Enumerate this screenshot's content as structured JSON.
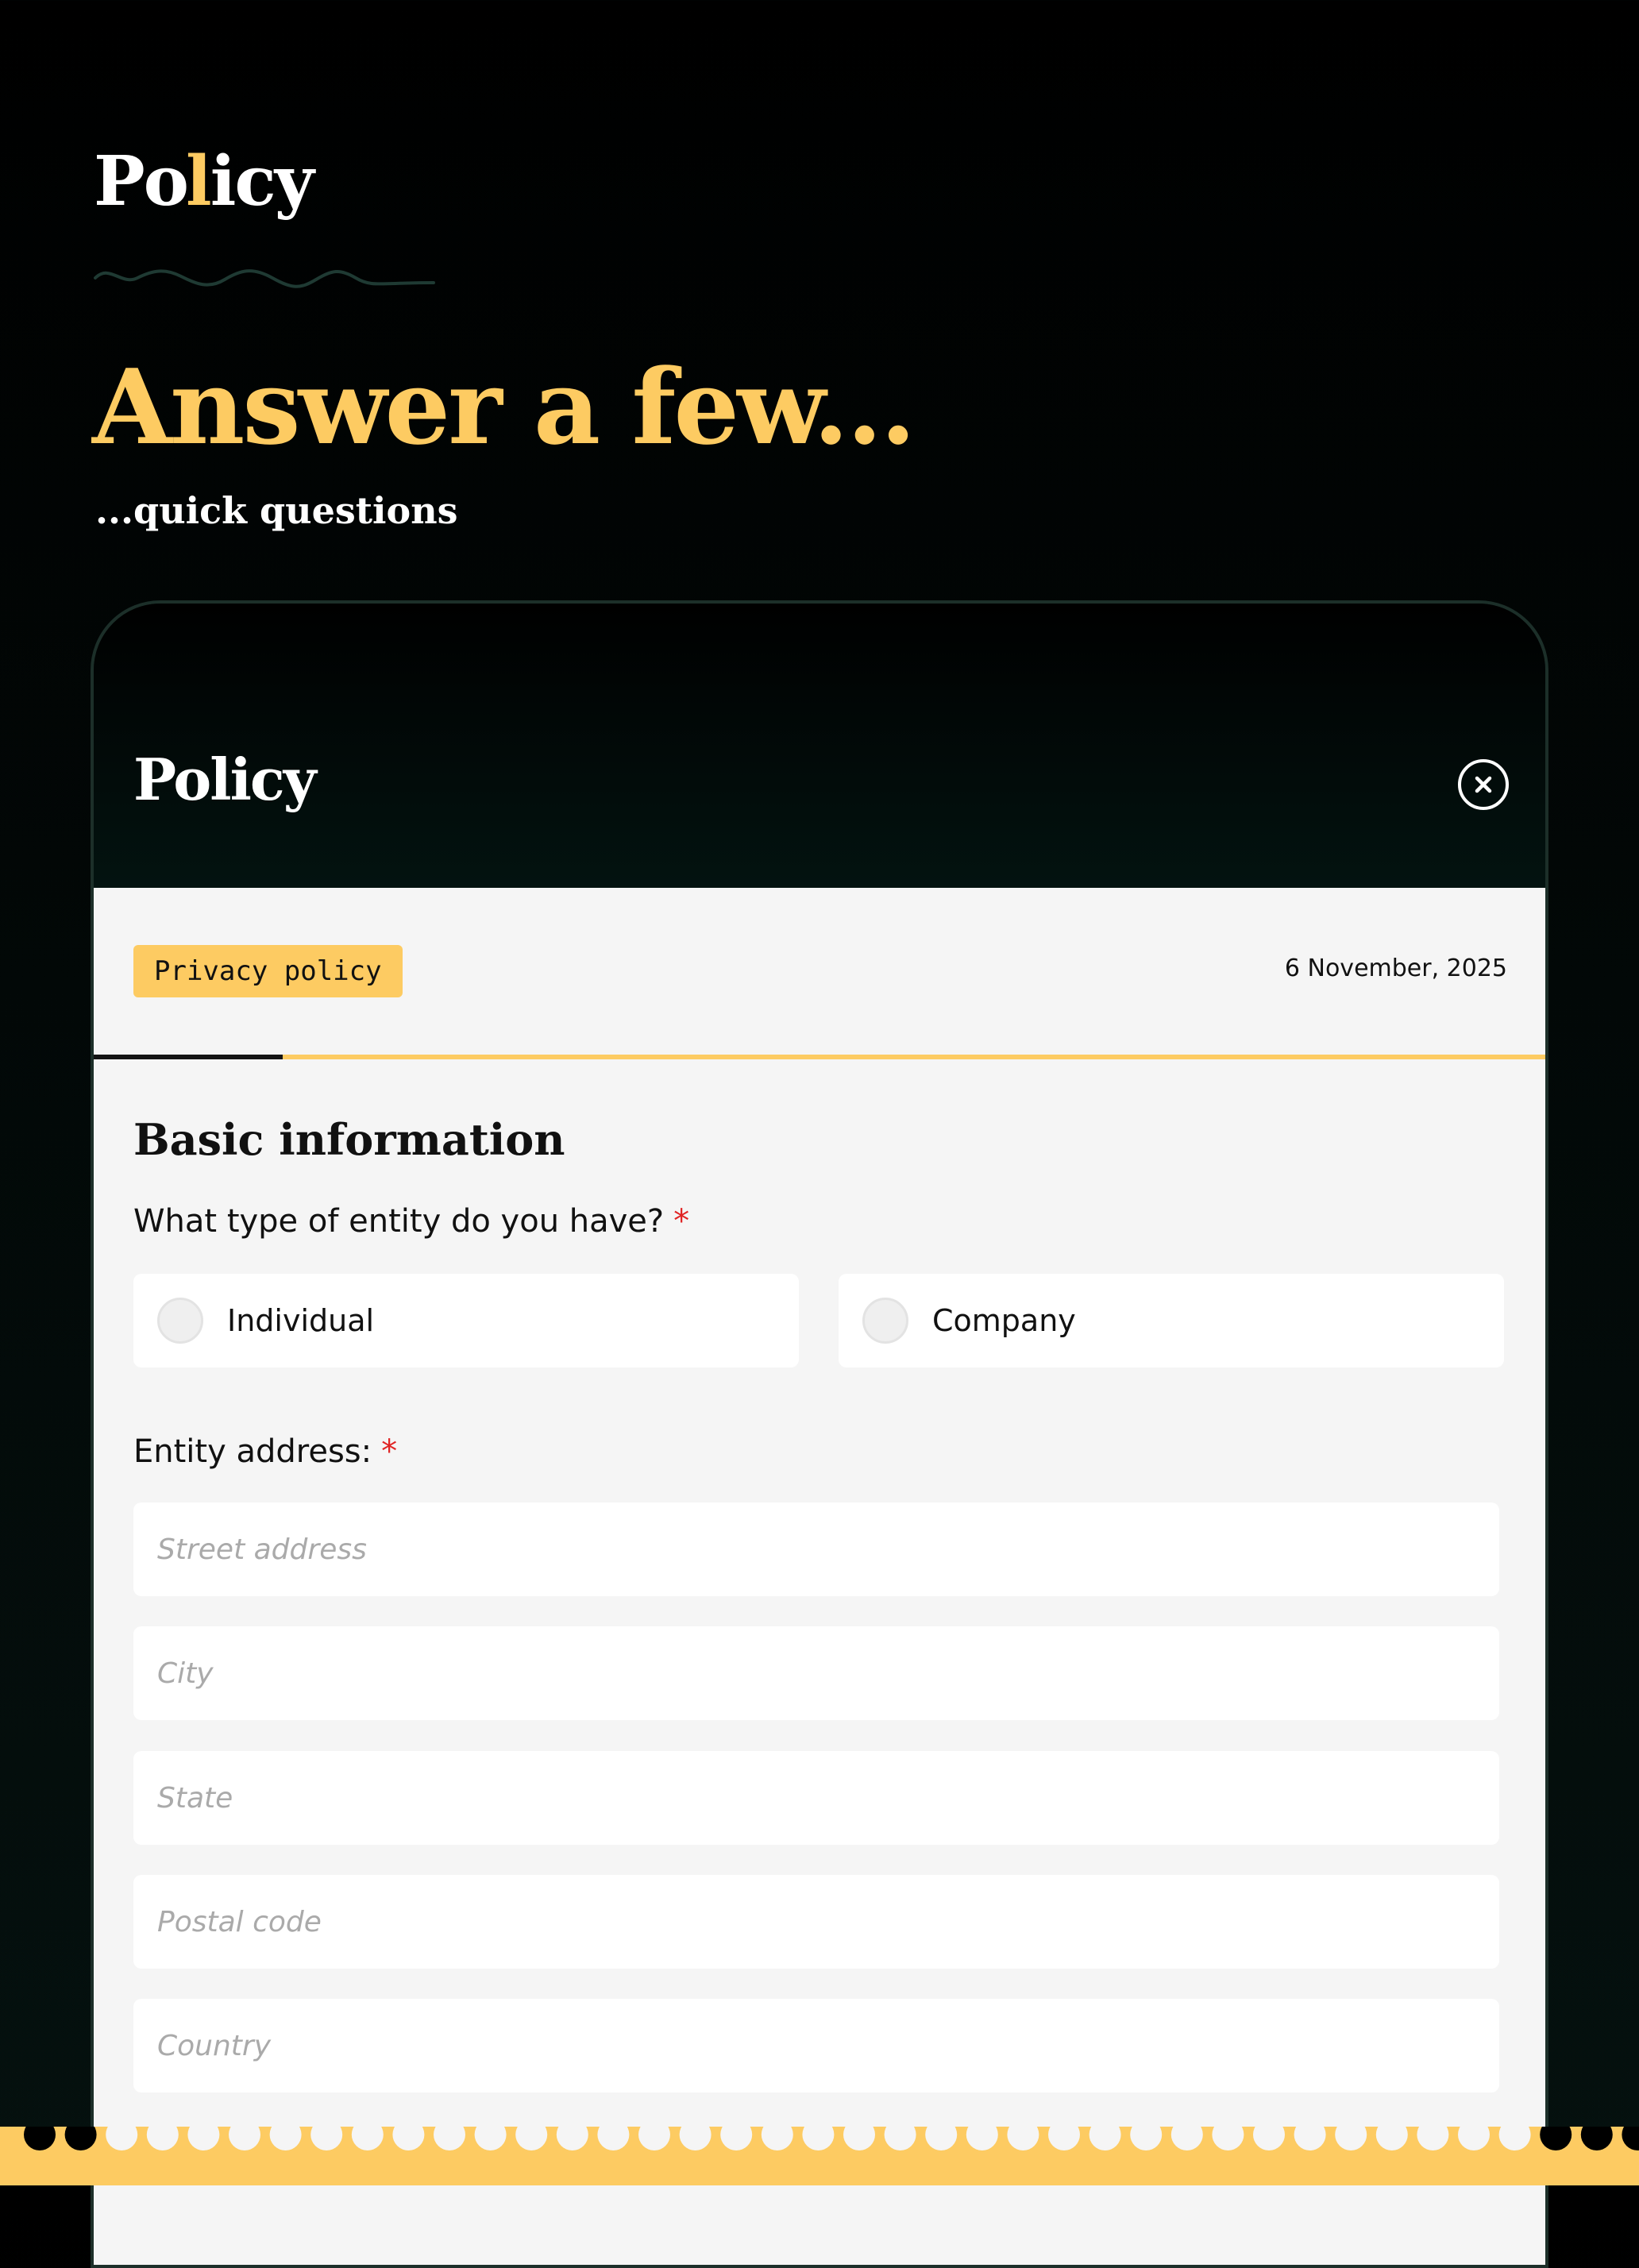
{
  "page": {
    "logo": "Policy",
    "title": "Answer a few...",
    "subtitle": "...quick questions"
  },
  "app": {
    "logo": "Policy",
    "close_icon": "close-circle-icon"
  },
  "document": {
    "badge": "Privacy policy",
    "date": "6 November, 2025",
    "progress_fraction": 0.13
  },
  "form": {
    "section_title": "Basic information",
    "entity_question": "What type of entity do you have?",
    "required_mark": "*",
    "entity_options": [
      {
        "label": "Individual",
        "selected": false
      },
      {
        "label": "Company",
        "selected": false
      }
    ],
    "address_label": "Entity address:",
    "address_fields": {
      "street": "Street address",
      "city": "City",
      "state": "State",
      "postal": "Postal code",
      "country": "Country"
    }
  },
  "colors": {
    "accent": "#fdcb62",
    "background": "#000000",
    "panel": "#f5f5f5",
    "required": "#e02424"
  }
}
